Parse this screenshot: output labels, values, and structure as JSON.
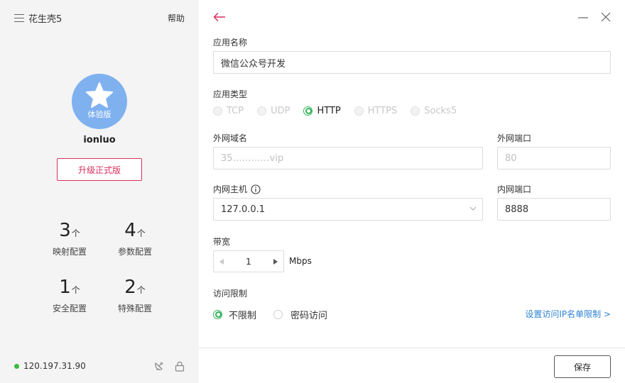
{
  "sidebar": {
    "app_title": "花生壳5",
    "help_label": "帮助",
    "avatar_label": "体验版",
    "username": "ionluo",
    "upgrade_label": "升级正式版",
    "stats": [
      {
        "value": "3",
        "unit": "个",
        "label": "映射配置"
      },
      {
        "value": "4",
        "unit": "个",
        "label": "参数配置"
      },
      {
        "value": "1",
        "unit": "个",
        "label": "安全配置"
      },
      {
        "value": "2",
        "unit": "个",
        "label": "特殊配置"
      }
    ],
    "ip": "120.197.31.90"
  },
  "form": {
    "app_name_label": "应用名称",
    "app_name_value": "微信公众号开发",
    "app_type_label": "应用类型",
    "app_types": [
      "TCP",
      "UDP",
      "HTTP",
      "HTTPS",
      "Socks5"
    ],
    "selected_type": "HTTP",
    "external_domain_label": "外网域名",
    "external_domain_value": "35…………vip",
    "external_port_label": "外网端口",
    "external_port_value": "80",
    "internal_host_label": "内网主机",
    "internal_host_value": "127.0.0.1",
    "internal_port_label": "内网端口",
    "internal_port_value": "8888",
    "bandwidth_label": "带宽",
    "bandwidth_value": "1",
    "bandwidth_unit": "Mbps",
    "access_label": "访问限制",
    "access_options": [
      "不限制",
      "密码访问"
    ],
    "ip_limit_link": "设置访问IP名单限制 >",
    "save_label": "保存"
  },
  "colors": {
    "accent_red": "#d9305e",
    "radio_green": "#32b25a",
    "link_blue": "#2c82d2",
    "avatar_blue": "#7fb1ef",
    "online_green": "#3dba3d"
  }
}
